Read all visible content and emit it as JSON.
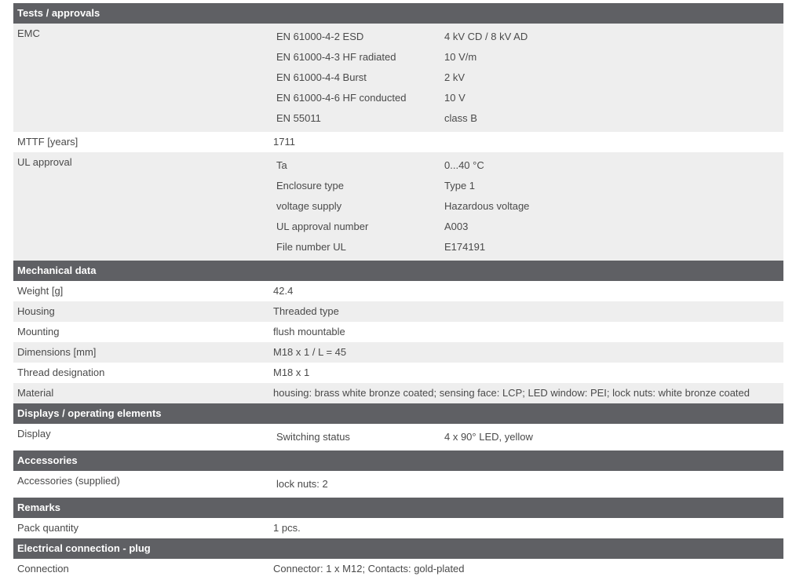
{
  "sections": {
    "tests": {
      "title": "Tests / approvals",
      "emc": {
        "label": "EMC",
        "items": [
          {
            "k": "EN 61000-4-2 ESD",
            "v": "4 kV CD / 8 kV AD"
          },
          {
            "k": "EN 61000-4-3 HF radiated",
            "v": "10 V/m"
          },
          {
            "k": "EN 61000-4-4 Burst",
            "v": "2 kV"
          },
          {
            "k": "EN 61000-4-6 HF conducted",
            "v": "10 V"
          },
          {
            "k": "EN 55011",
            "v": "class B"
          }
        ]
      },
      "mttf": {
        "label": "MTTF [years]",
        "value": "1711"
      },
      "ul": {
        "label": "UL approval",
        "items": [
          {
            "k": "Ta",
            "v": "0...40 °C"
          },
          {
            "k": "Enclosure type",
            "v": "Type 1"
          },
          {
            "k": "voltage supply",
            "v": "Hazardous voltage"
          },
          {
            "k": "UL approval number",
            "v": "A003"
          },
          {
            "k": "File number UL",
            "v": "E174191"
          }
        ]
      }
    },
    "mechanical": {
      "title": "Mechanical data",
      "rows": [
        {
          "label": "Weight [g]",
          "value": "42.4"
        },
        {
          "label": "Housing",
          "value": "Threaded type"
        },
        {
          "label": "Mounting",
          "value": "flush mountable"
        },
        {
          "label": "Dimensions [mm]",
          "value": "M18 x 1 / L = 45"
        },
        {
          "label": "Thread designation",
          "value": "M18 x 1"
        },
        {
          "label": "Material",
          "value": "housing: brass white bronze coated; sensing face: LCP; LED window: PEI; lock nuts: white bronze coated"
        }
      ]
    },
    "displays": {
      "title": "Displays / operating elements",
      "display": {
        "label": "Display",
        "k": "Switching status",
        "v": "4 x 90° LED, yellow"
      }
    },
    "accessories": {
      "title": "Accessories",
      "row": {
        "label": "Accessories (supplied)",
        "k": "lock nuts: 2"
      }
    },
    "remarks": {
      "title": "Remarks",
      "row": {
        "label": "Pack quantity",
        "value": "1 pcs."
      }
    },
    "electrical": {
      "title": "Electrical connection - plug",
      "row": {
        "label": "Connection",
        "value": "Connector: 1 x M12; Contacts: gold-plated"
      }
    }
  }
}
